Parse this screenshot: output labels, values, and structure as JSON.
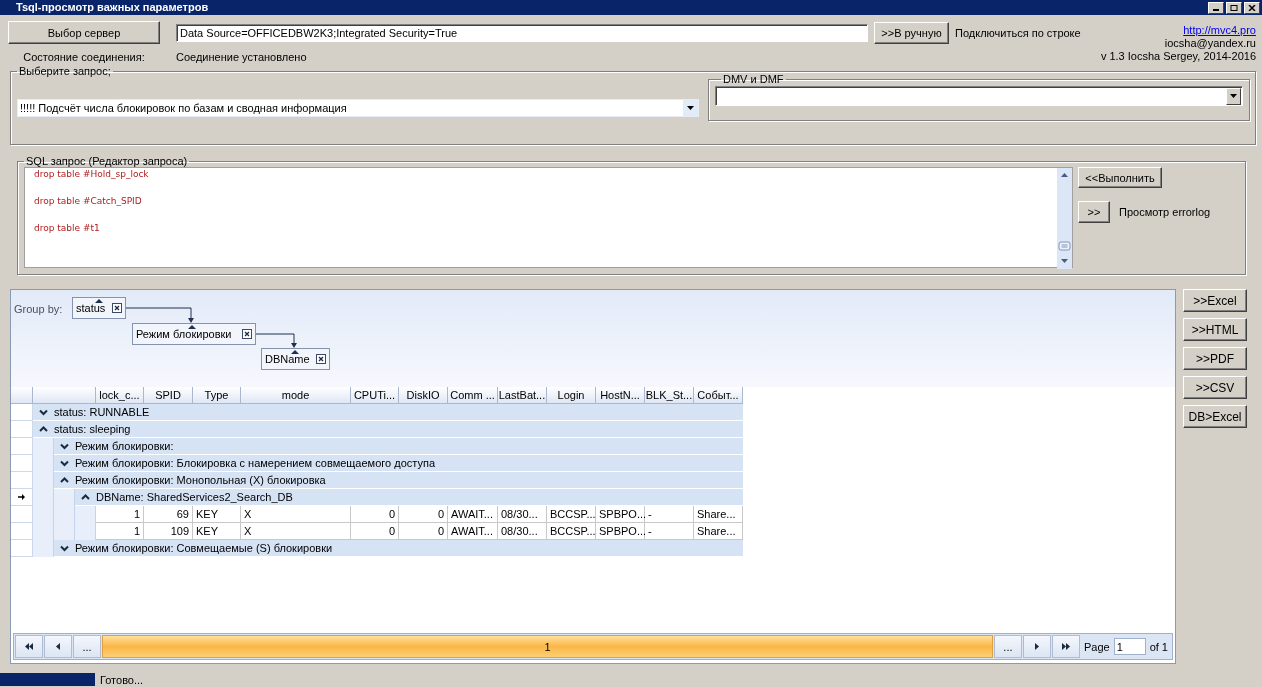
{
  "window": {
    "title": "Tsql-просмотр важных параметров"
  },
  "connection": {
    "server_button": "Выбор  сервер",
    "connection_string": "Data Source=OFFICEDBW2K3;Integrated Security=True",
    "manual_button": ">>В ручную",
    "manual_label": "Подключиться  по строке",
    "status_label": "Состояние  соединения:",
    "status_value": "Соединение установлено"
  },
  "about": {
    "link": "http://mvc4.pro",
    "email": "iocsha@yandex.ru",
    "version": "v 1.3 Iocsha Sergey, 2014-2016"
  },
  "query_select": {
    "title": "Выберите  запрос;",
    "value": "!!!!! Подсчёт числа блокировок по базам и сводная  информация",
    "dmv_title": "DMV и DMF"
  },
  "sql_editor": {
    "title": "SQL запрос (Редактор запроса)",
    "lines": [
      "drop table #Hold_sp_lock",
      "drop table #Catch_SPID",
      "drop table #t1"
    ],
    "run_button": "<<Выполнить",
    "errorlog_button": ">>",
    "errorlog_label": "Просмотр errorlog"
  },
  "grid": {
    "group_by_label": "Group by:",
    "group_chips": [
      {
        "label": "status"
      },
      {
        "label": "Режим блокировки"
      },
      {
        "label": "DBName"
      }
    ],
    "columns": [
      {
        "label": "lock_c...",
        "numeric": true
      },
      {
        "label": "SPID",
        "numeric": true
      },
      {
        "label": "Type",
        "numeric": false
      },
      {
        "label": "mode",
        "numeric": false
      },
      {
        "label": "CPUTi...",
        "numeric": true
      },
      {
        "label": "DiskIO",
        "numeric": true
      },
      {
        "label": "Comm ...",
        "numeric": false
      },
      {
        "label": "LastBat...",
        "numeric": false
      },
      {
        "label": "Login",
        "numeric": false
      },
      {
        "label": "HostN...",
        "numeric": false
      },
      {
        "label": "BLK_St...",
        "numeric": false
      },
      {
        "label": "Событ...",
        "numeric": false
      }
    ],
    "groups": [
      {
        "label": "status: RUNNABLE",
        "expanded": false,
        "current": false
      },
      {
        "label": "status: sleeping",
        "expanded": true,
        "current": false,
        "children": [
          {
            "label": "Режим блокировки:",
            "expanded": false,
            "current": false
          },
          {
            "label": "Режим блокировки: Блокировка с намерением совмещаемого доступа",
            "expanded": false,
            "current": false
          },
          {
            "label": "Режим блокировки: Монопольная (X) блокировка",
            "expanded": true,
            "current": false,
            "children": [
              {
                "label": "DBName: SharedServices2_Search_DB",
                "expanded": true,
                "current": true,
                "rows": [
                  [
                    "1",
                    "69",
                    "KEY",
                    "X",
                    "0",
                    "0",
                    "AWAIT...",
                    "08/30...",
                    "BCCSP...",
                    "SPBPO...",
                    "-",
                    "Share..."
                  ],
                  [
                    "1",
                    "109",
                    "KEY",
                    "X",
                    "0",
                    "0",
                    "AWAIT...",
                    "08/30...",
                    "BCCSP...",
                    "SPBPO...",
                    "-",
                    "Share..."
                  ]
                ]
              }
            ]
          },
          {
            "label": "Режим блокировки: Совмещаемые (S) блокировки",
            "expanded": false,
            "current": false
          }
        ]
      }
    ]
  },
  "pager": {
    "left_more": "...",
    "page_number": "1",
    "right_more": "...",
    "page_label": "Page",
    "page_value": "1",
    "page_of": "of 1"
  },
  "export_buttons": [
    ">>Excel",
    ">>HTML",
    ">>PDF",
    ">>CSV",
    "DB>Excel"
  ],
  "status_bar": {
    "text": "Готово..."
  }
}
